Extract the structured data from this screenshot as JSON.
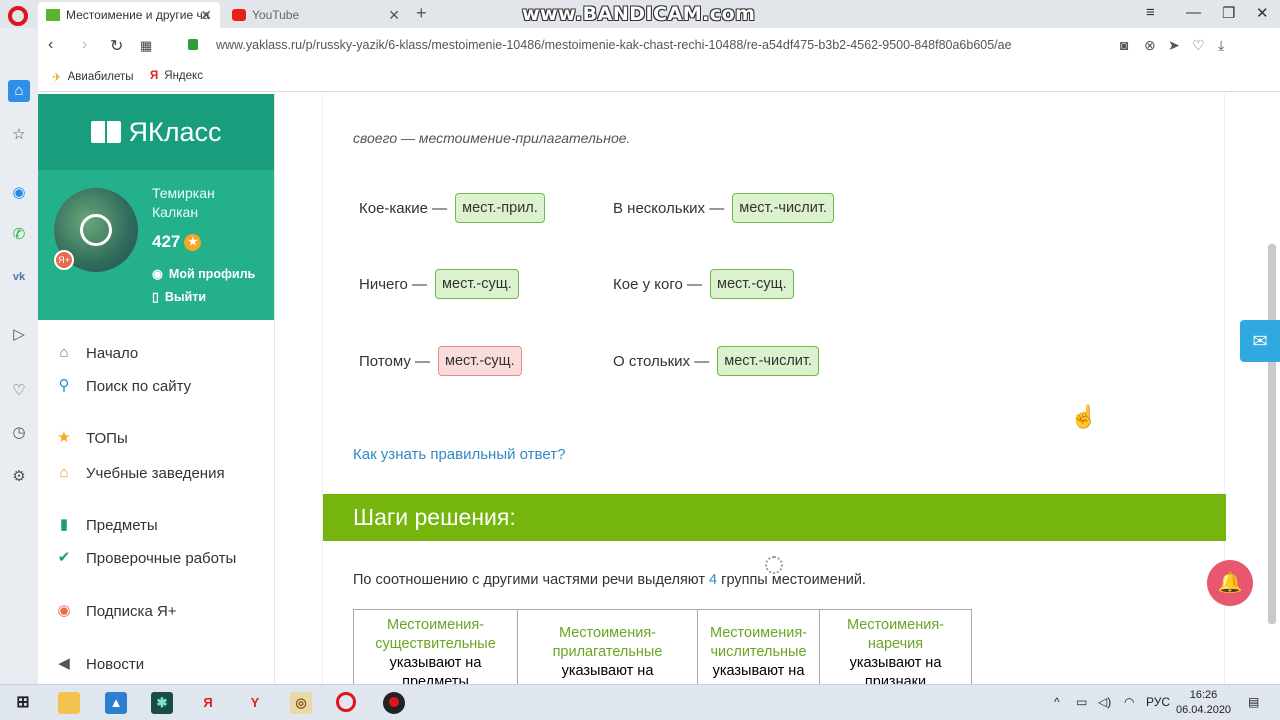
{
  "browser": {
    "tabs": [
      {
        "label": "Местоимение и другие ча",
        "active": true
      },
      {
        "label": "YouTube",
        "active": false
      }
    ],
    "watermark": "www.BANDICAM.com",
    "url": "www.yaklass.ru/p/russky-yazik/6-klass/mestoimenie-10486/mestoimenie-kak-chast-rechi-10488/re-a54df475-b3b2-4562-9500-848f80a6b605/ae",
    "bookmarks": [
      "Авиабилеты",
      "Яндекс"
    ]
  },
  "site": {
    "logo": "ЯКласс",
    "user": {
      "first_name": "Темиркан",
      "last_name": "Калкан",
      "points": "427",
      "profile_link": "Мой профиль",
      "logout_link": "Выйти"
    },
    "menu": [
      {
        "label": "Начало"
      },
      {
        "label": "Поиск по сайту"
      },
      {
        "label": "ТОПы"
      },
      {
        "label": "Учебные заведения"
      },
      {
        "label": "Предметы"
      },
      {
        "label": "Проверочные работы"
      },
      {
        "label": "Подписка Я+"
      },
      {
        "label": "Новости"
      }
    ]
  },
  "content": {
    "answer_line": "своего — местоимение-прилагательное.",
    "pairs": [
      {
        "word": "Кое-какие —",
        "answer": "мест.-прил.",
        "correct": true
      },
      {
        "word": "В нескольких —",
        "answer": "мест.-числит.",
        "correct": true
      },
      {
        "word": "Ничего —",
        "answer": "мест.-сущ.",
        "correct": true
      },
      {
        "word": "Кое у кого —",
        "answer": "мест.-сущ.",
        "correct": true
      },
      {
        "word": "Потому —",
        "answer": "мест.-сущ.",
        "correct": false
      },
      {
        "word": "О стольких —",
        "answer": "мест.-числит.",
        "correct": true
      }
    ],
    "how_link": "Как узнать правильный ответ?",
    "steps_title": "Шаги решения:",
    "steps_text_before": "По соотношению с другими частями речи выделяют",
    "steps_number": "4",
    "steps_text_after": "группы местоимений.",
    "groups": [
      {
        "title": "Местоимения-существительные",
        "desc": "указывают на предметы"
      },
      {
        "title": "Местоимения-прилагательные",
        "desc": "указывают на"
      },
      {
        "title": "Местоимения-числительные",
        "desc": "указывают на"
      },
      {
        "title": "Местоимения-наречия",
        "desc": "указывают на признаки"
      }
    ]
  },
  "taskbar": {
    "lang": "РУС",
    "time": "16:26",
    "date": "06.04.2020"
  },
  "colors": {
    "brand_green": "#189e7c",
    "steps_green": "#76b50d",
    "link_blue": "#2f8bc4",
    "correct_bg": "#dcf2cf",
    "wrong_bg": "#fbdcdc"
  }
}
